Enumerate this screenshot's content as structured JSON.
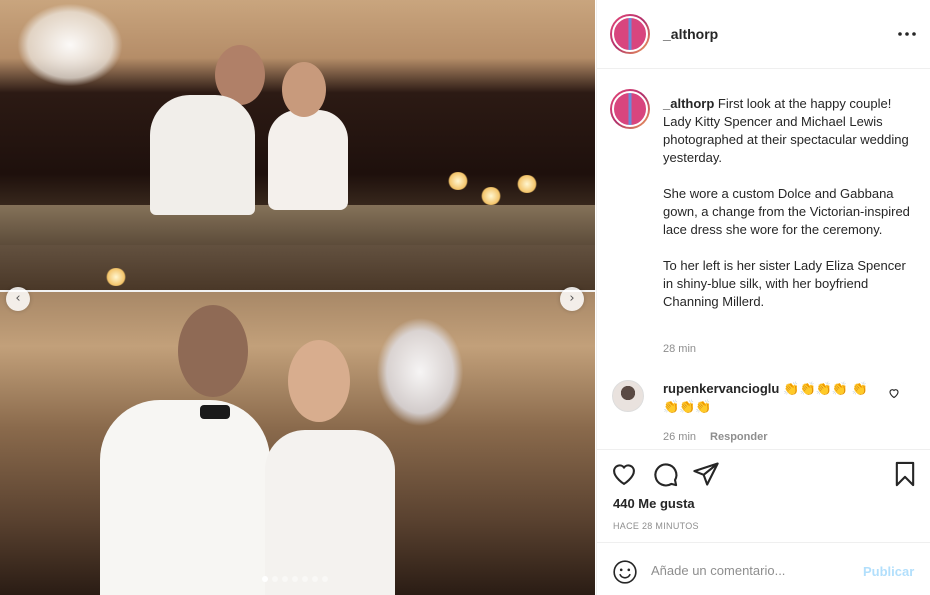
{
  "post": {
    "username": "_althorp",
    "more_icon": "more-horizontal-icon"
  },
  "media": {
    "nav_prev_icon": "chevron-left-icon",
    "nav_next_icon": "chevron-right-icon",
    "nav_prev_glyph": "‹",
    "nav_next_glyph": "›",
    "carousel_total": 7,
    "carousel_active_index": 0
  },
  "caption": {
    "username": "_althorp",
    "paragraphs": [
      "First look at the happy couple! Lady Kitty Spencer and Michael Lewis photographed at their spectacular wedding yesterday.",
      "She wore a custom Dolce and Gabbana gown, a change from the Victorian-inspired lace dress she wore for the ceremony.",
      "To her left is her sister Lady Eliza Spencer in shiny-blue silk, with her boyfriend Channing Millerd."
    ],
    "time": "28 min"
  },
  "comments": [
    {
      "username": "rupenkervancioglu",
      "text": "👏👏👏👏 👏👏👏👏",
      "time": "26 min",
      "reply_label": "Responder"
    }
  ],
  "actions": {
    "likes": "440 Me gusta",
    "timestamp": "HACE 28 MINUTOS"
  },
  "add_comment": {
    "placeholder": "Añade un comentario...",
    "post_label": "Publicar"
  },
  "colors": {
    "text": "#262626",
    "secondary": "#8e8e8e",
    "border": "#efefef",
    "post_button_disabled": "#b2dffc"
  }
}
